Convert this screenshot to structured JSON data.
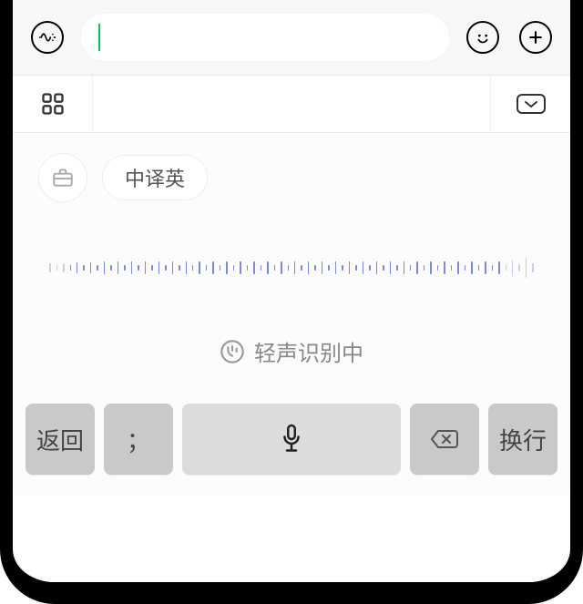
{
  "input": {
    "placeholder": ""
  },
  "chips": {
    "translate_label": "中译英"
  },
  "status": {
    "text": "轻声识别中"
  },
  "keys": {
    "return": "返回",
    "semicolon": "；",
    "newline": "换行"
  },
  "accent": "#00c853",
  "wave_heights": [
    10,
    6,
    10,
    6,
    12,
    6,
    12,
    6,
    14,
    6,
    14,
    6,
    14,
    6,
    14,
    6,
    14,
    6,
    14,
    6,
    14,
    6,
    14,
    6,
    14,
    6,
    14,
    6,
    14,
    6,
    14,
    6,
    14,
    6,
    14,
    6,
    14,
    6,
    14,
    6,
    14,
    6,
    14,
    6,
    14,
    6,
    14,
    6,
    14,
    6,
    14,
    6,
    14,
    6,
    14,
    6,
    14,
    6,
    14,
    6,
    14,
    6,
    14,
    6,
    14,
    6,
    14,
    6,
    18,
    8,
    22,
    10
  ]
}
